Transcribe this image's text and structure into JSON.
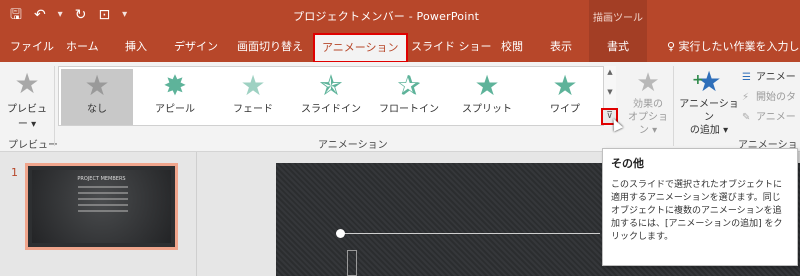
{
  "titlebar": {
    "qat": {
      "save_icon": "save-icon",
      "undo_icon": "undo-icon",
      "redo_icon": "repeat-icon",
      "present_icon": "present-icon",
      "customize_icon": "customize-icon"
    },
    "title": "プロジェクトメンバー - PowerPoint",
    "context_group": "描画ツール"
  },
  "tabs": [
    "ファイル",
    "ホーム",
    "挿入",
    "デザイン",
    "画面切り替え",
    "アニメーション",
    "スライド ショー",
    "校閲",
    "表示",
    "書式"
  ],
  "active_tab": "アニメーション",
  "tell_me": "♀ 実行したい作業を入力して",
  "ribbon": {
    "preview": {
      "label": "プレビュー",
      "group": "プレビュー"
    },
    "gallery": {
      "items": [
        {
          "label": "なし",
          "selected": true
        },
        {
          "label": "アピール"
        },
        {
          "label": "フェード"
        },
        {
          "label": "スライドイン"
        },
        {
          "label": "フロートイン"
        },
        {
          "label": "スプリット"
        },
        {
          "label": "ワイプ"
        }
      ],
      "group": "アニメーション"
    },
    "effect_options": {
      "line1": "効果の",
      "line2": "オプション ▾"
    },
    "add_animation": {
      "line1": "アニメーション",
      "line2": "の追加 ▾"
    },
    "advanced": {
      "items": [
        "アニメー",
        "開始のタ",
        "アニメー"
      ],
      "group": "アニメーションの"
    }
  },
  "slide_panel": {
    "slide_number": "1",
    "thumb_title": "PROJECT MEMBERS"
  },
  "tooltip": {
    "title": "その他",
    "body": "このスライドで選択されたオブジェクトに適用するアニメーションを選びます。同じオブジェクトに複数のアニメーションを追加するには、[アニメーションの追加] をクリックします。"
  },
  "colors": {
    "accent": "#b7472a",
    "highlight": "#e00000",
    "star": "#5eb39a"
  }
}
